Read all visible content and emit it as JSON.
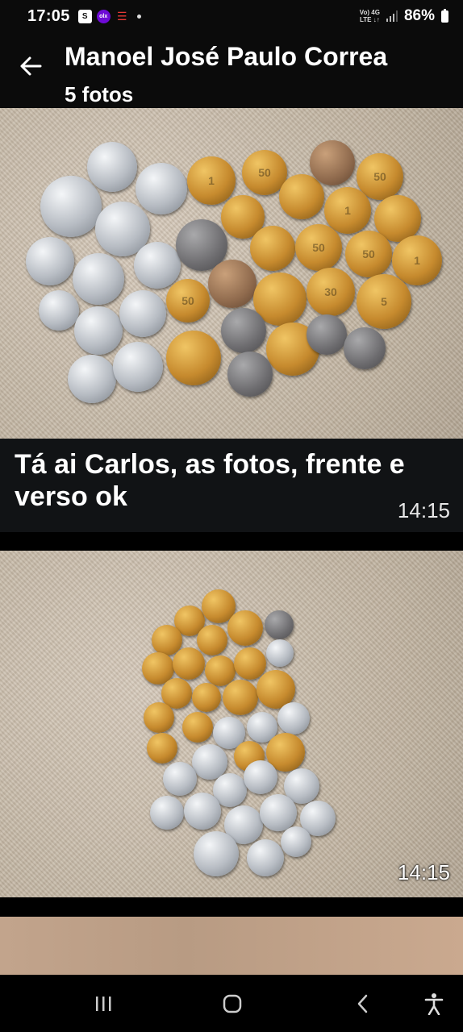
{
  "status_bar": {
    "time": "17:05",
    "network_top": "Vo) 4G",
    "network_bottom": "LTE ↓↑",
    "battery": "86%"
  },
  "header": {
    "title": "Manoel José Paulo Correa",
    "subtitle": "5 fotos"
  },
  "message": {
    "caption": "Tá ai Carlos, as fotos, frente e verso ok",
    "caption_time": "14:15",
    "photo_time": "14:15"
  },
  "icons": {
    "back": "arrow-left-icon",
    "recents": "recents-icon",
    "home": "home-icon",
    "nav_back": "chevron-left-icon",
    "accessibility": "accessibility-icon"
  }
}
